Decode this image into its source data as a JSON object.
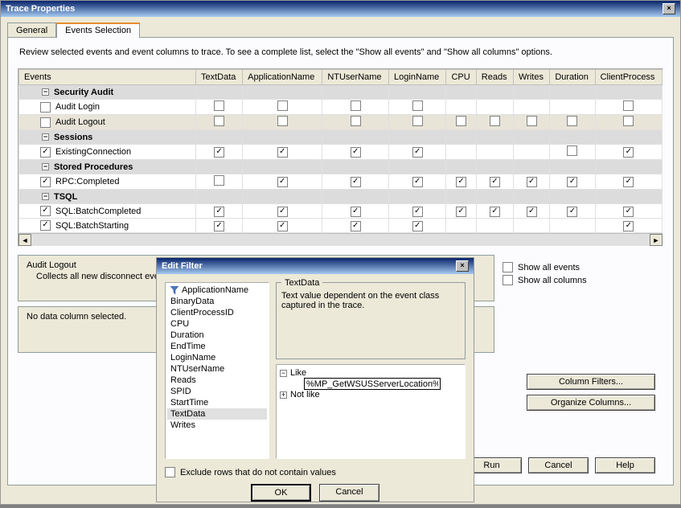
{
  "mainWindow": {
    "title": "Trace Properties",
    "tabs": [
      {
        "label": "General",
        "active": false
      },
      {
        "label": "Events Selection",
        "active": true
      }
    ],
    "description": "Review selected events and event columns to trace. To see a complete list, select the \"Show all events\" and \"Show all columns\" options.",
    "columns": [
      "Events",
      "TextData",
      "ApplicationName",
      "NTUserName",
      "LoginName",
      "CPU",
      "Reads",
      "Writes",
      "Duration",
      "ClientProcess"
    ],
    "categories": [
      {
        "name": "Security Audit",
        "events": [
          {
            "name": "Audit Login",
            "checked": false,
            "cells": [
              false,
              false,
              false,
              false,
              null,
              null,
              null,
              null,
              false
            ],
            "highlight": false
          },
          {
            "name": "Audit Logout",
            "checked": false,
            "cells": [
              false,
              false,
              false,
              false,
              false,
              false,
              false,
              false,
              false
            ],
            "highlight": true
          }
        ]
      },
      {
        "name": "Sessions",
        "events": [
          {
            "name": "ExistingConnection",
            "checked": true,
            "cells": [
              true,
              true,
              true,
              true,
              null,
              null,
              null,
              false,
              true
            ],
            "highlight": false
          }
        ]
      },
      {
        "name": "Stored Procedures",
        "events": [
          {
            "name": "RPC:Completed",
            "checked": true,
            "cells": [
              false,
              true,
              true,
              true,
              true,
              true,
              true,
              true,
              true
            ],
            "highlight": false
          }
        ]
      },
      {
        "name": "TSQL",
        "events": [
          {
            "name": "SQL:BatchCompleted",
            "checked": true,
            "cells": [
              true,
              true,
              true,
              true,
              true,
              true,
              true,
              true,
              true
            ],
            "highlight": false
          },
          {
            "name": "SQL:BatchStarting",
            "checked": true,
            "cells": [
              true,
              true,
              true,
              true,
              null,
              null,
              null,
              null,
              true
            ],
            "highlight": false
          }
        ]
      }
    ],
    "infoBox1": {
      "title": "Audit Logout",
      "text": "Collects all new disconnect eve"
    },
    "infoBox2": {
      "text": "No data column selected."
    },
    "showAllEvents": {
      "label": "Show all events",
      "checked": false
    },
    "showAllColumns": {
      "label": "Show all columns",
      "checked": false
    },
    "columnFiltersBtn": "Column Filters...",
    "organizeColumnsBtn": "Organize Columns...",
    "runBtn": "Run",
    "cancelBtn": "Cancel",
    "helpBtn": "Help"
  },
  "editFilter": {
    "title": "Edit Filter",
    "columns": [
      "ApplicationName",
      "BinaryData",
      "ClientProcessID",
      "CPU",
      "Duration",
      "EndTime",
      "LoginName",
      "NTUserName",
      "Reads",
      "SPID",
      "StartTime",
      "TextData",
      "Writes"
    ],
    "filteredColumn": "ApplicationName",
    "selectedColumn": "TextData",
    "fieldset": {
      "title": "TextData",
      "desc": "Text value dependent on the event class captured in the trace."
    },
    "tree": {
      "like": "Like",
      "likeValue": "%MP_GetWSUSServerLocation%",
      "notLike": "Not like"
    },
    "excludeLabel": "Exclude rows that do not contain values",
    "excludeChecked": false,
    "okBtn": "OK",
    "cancelBtn": "Cancel"
  }
}
